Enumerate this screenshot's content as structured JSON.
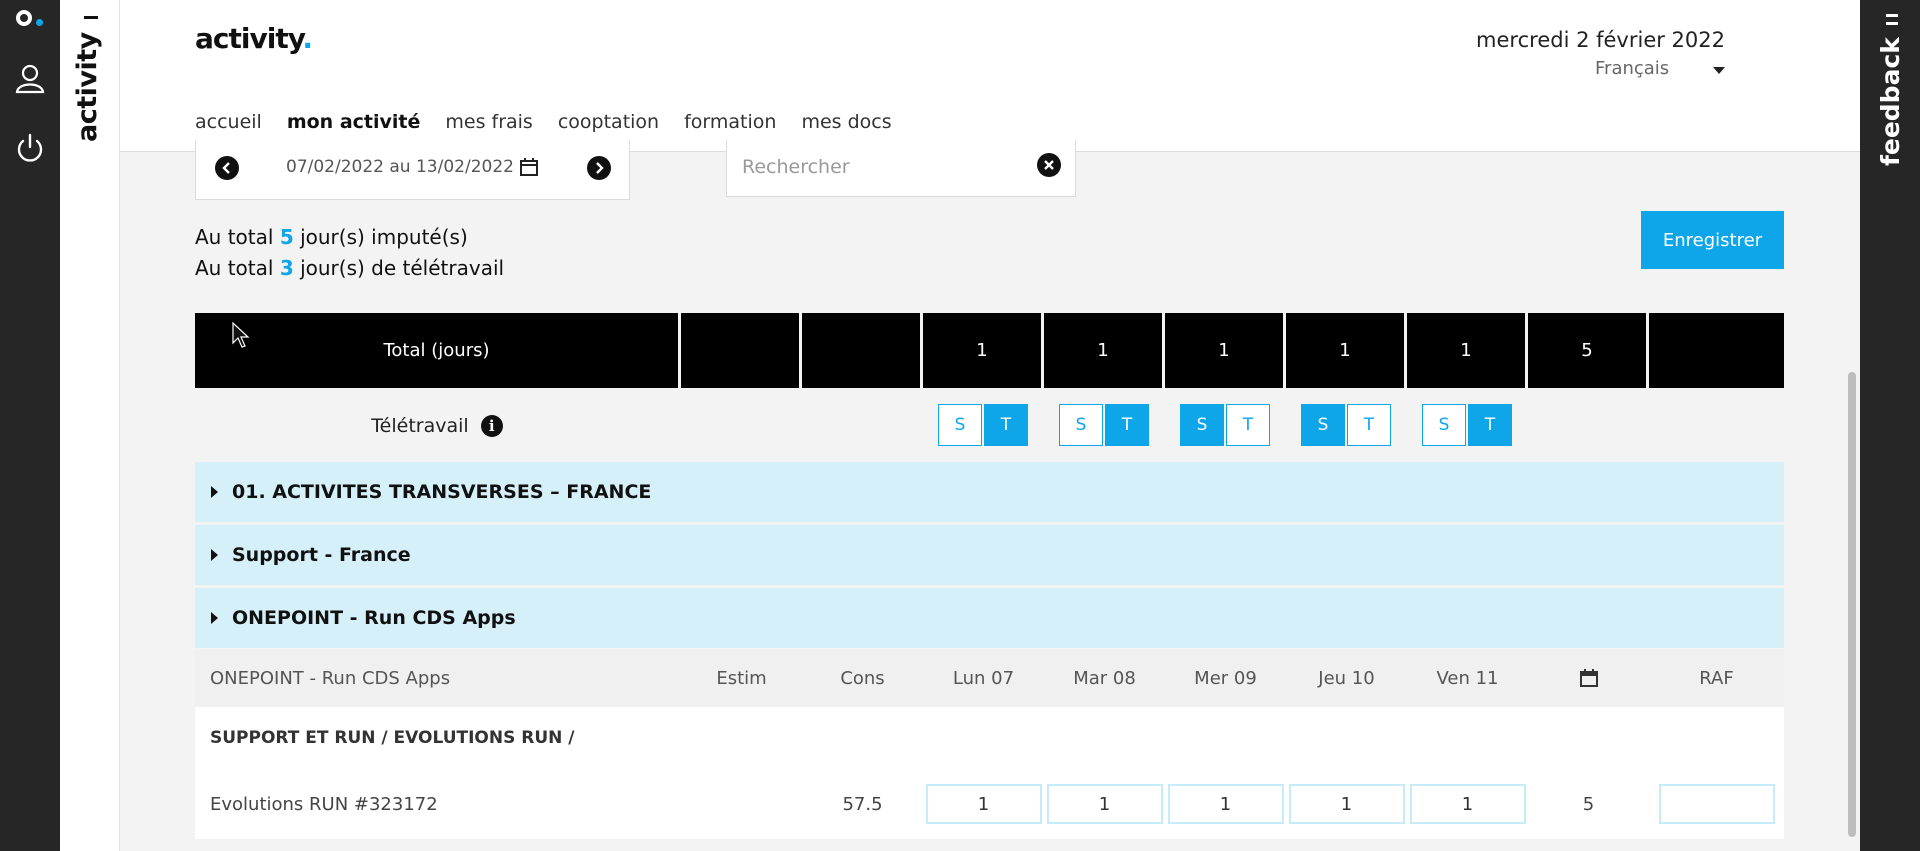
{
  "rail": {
    "icons": [
      "user-icon",
      "power-icon"
    ]
  },
  "brand_strip": {
    "text": "activity"
  },
  "feedback": {
    "text": "feedback"
  },
  "header": {
    "brand": "activity",
    "brand_dot": ".",
    "date": "mercredi 2 février 2022",
    "language": "Français"
  },
  "nav": [
    {
      "label": "accueil",
      "active": false
    },
    {
      "label": "mon activité",
      "active": true
    },
    {
      "label": "mes frais",
      "active": false
    },
    {
      "label": "cooptation",
      "active": false
    },
    {
      "label": "formation",
      "active": false
    },
    {
      "label": "mes docs",
      "active": false
    }
  ],
  "date_range": {
    "text": "07/02/2022 au 13/02/2022"
  },
  "search": {
    "placeholder": "Rechercher",
    "value": ""
  },
  "totals": {
    "imputes_prefix": "Au total ",
    "imputes_value": "5",
    "imputes_suffix": " jour(s) imputé(s)",
    "teletravail_prefix": "Au total ",
    "teletravail_value": "3",
    "teletravail_suffix": " jour(s) de télétravail"
  },
  "save_button": "Enregistrer",
  "total_row": {
    "label": "Total (jours)",
    "estim": "",
    "cons": "",
    "days": [
      "1",
      "1",
      "1",
      "1",
      "1"
    ],
    "total": "5",
    "raf": ""
  },
  "teletravail": {
    "label": "Télétravail",
    "days": [
      {
        "s": "S",
        "t": "T",
        "selected": "T"
      },
      {
        "s": "S",
        "t": "T",
        "selected": "T"
      },
      {
        "s": "S",
        "t": "T",
        "selected": "S"
      },
      {
        "s": "S",
        "t": "T",
        "selected": "S"
      },
      {
        "s": "S",
        "t": "T",
        "selected": "T"
      }
    ]
  },
  "groups": [
    "01. ACTIVITES TRANSVERSES – FRANCE",
    "Support - France",
    "ONEPOINT - Run CDS Apps"
  ],
  "project_header": {
    "name": "ONEPOINT - Run CDS Apps",
    "estim": "Estim",
    "cons": "Cons",
    "days": [
      "Lun 07",
      "Mar 08",
      "Mer 09",
      "Jeu 10",
      "Ven 11"
    ],
    "raf": "RAF"
  },
  "section": "SUPPORT ET RUN / EVOLUTIONS RUN /",
  "item": {
    "name": "Evolutions RUN #323172",
    "estim": "",
    "cons": "57.5",
    "days": [
      "1",
      "1",
      "1",
      "1",
      "1"
    ],
    "total": "5",
    "raf": ""
  }
}
